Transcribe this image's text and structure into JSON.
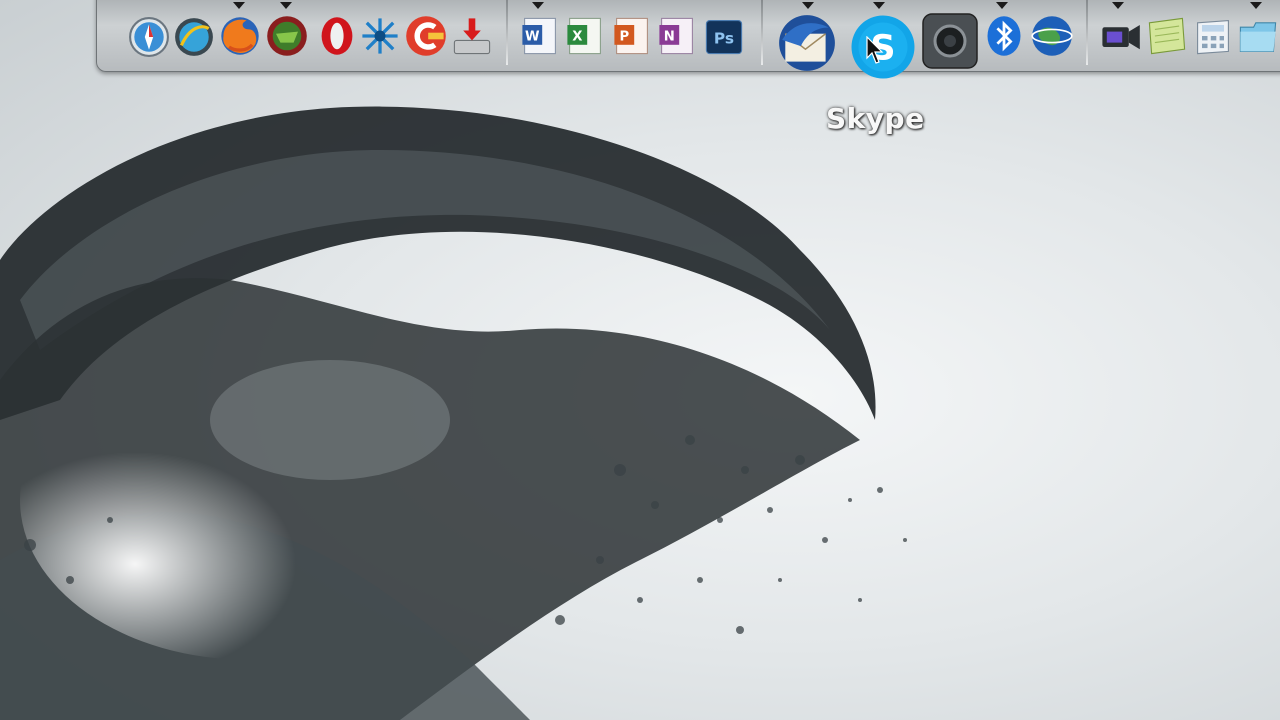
{
  "dock": {
    "tooltip_label": "Skype",
    "icons": [
      {
        "name": "safari-icon",
        "running": false
      },
      {
        "name": "internet-explorer-icon",
        "running": false
      },
      {
        "name": "firefox-icon",
        "running": true
      },
      {
        "name": "greenish-app-icon",
        "running": true
      },
      {
        "name": "opera-icon",
        "running": false
      },
      {
        "name": "star-burst-app-icon",
        "running": false
      },
      {
        "name": "ccleaner-icon",
        "running": false
      },
      {
        "name": "download-icon",
        "running": false
      },
      {
        "name": "word-icon",
        "running": false
      },
      {
        "name": "excel-icon",
        "running": false
      },
      {
        "name": "powerpoint-icon",
        "running": false
      },
      {
        "name": "onenote-icon",
        "running": false
      },
      {
        "name": "photoshop-icon",
        "running": false
      },
      {
        "name": "thunderbird-icon",
        "running": true
      },
      {
        "name": "skype-icon",
        "running": true
      },
      {
        "name": "camera-icon",
        "running": false
      },
      {
        "name": "bluetooth-icon",
        "running": true
      },
      {
        "name": "google-earth-icon",
        "running": false
      },
      {
        "name": "video-camera-icon",
        "running": true
      },
      {
        "name": "notes-icon",
        "running": false
      },
      {
        "name": "calculator-icon",
        "running": false
      },
      {
        "name": "folder-icon",
        "running": true
      }
    ]
  },
  "colors": {
    "dock_bg": "#c4c8ca",
    "tooltip_text": "#f8f8f8",
    "skype_blue": "#12a5e8"
  }
}
